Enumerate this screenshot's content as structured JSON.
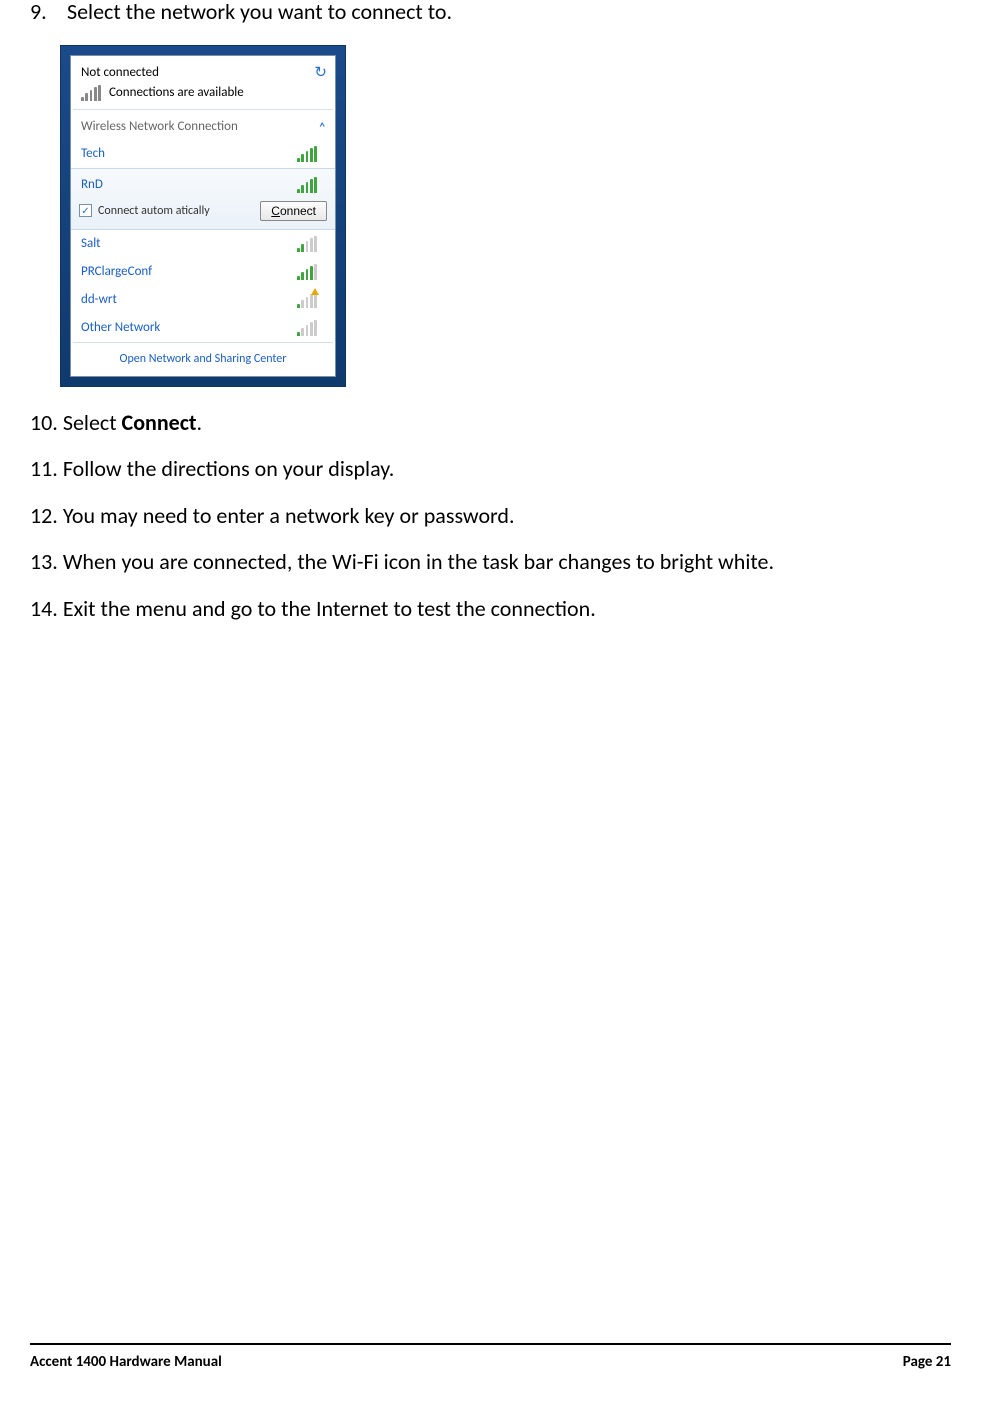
{
  "steps": {
    "s9": {
      "num": "9.",
      "text": "Select the network you want to connect to."
    },
    "s10": {
      "num": "10.",
      "prefix": "Select ",
      "bold": "Connect",
      "suffix": "."
    },
    "s11": {
      "num": "11.",
      "text": "Follow the directions on your display."
    },
    "s12": {
      "num": "12.",
      "text": "You may need to enter a network key or password."
    },
    "s13": {
      "num": "13.",
      "text": "When you are connected, the Wi-Fi icon in the task bar changes to bright white."
    },
    "s14": {
      "num": "14.",
      "text": "Exit the menu and go to the Internet to test the connection."
    }
  },
  "flyout": {
    "status": "Not connected",
    "avail": "Connections are available",
    "section": "Wireless Network Connection",
    "networks": {
      "n0": "Tech",
      "n1": "RnD",
      "n2": "Salt",
      "n3": "PRClargeConf",
      "n4": "dd-wrt",
      "n5": "Other Network"
    },
    "auto_label": "Connect autom atically",
    "connect_u": "C",
    "connect_rest": "onnect",
    "footer": "Open Network and Sharing Center"
  },
  "footer": {
    "title": "Accent 1400 Hardware Manual",
    "page": "Page 21"
  }
}
